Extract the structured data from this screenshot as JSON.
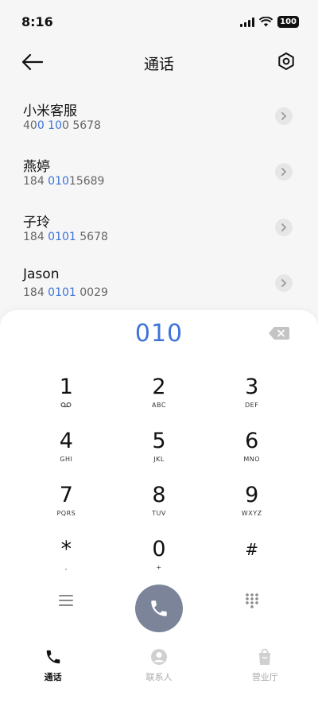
{
  "status_bar": {
    "time": "8:16",
    "battery": "100"
  },
  "header": {
    "title": "通话"
  },
  "results": [
    {
      "name": "小米客服",
      "number_parts": [
        "40",
        "0 10",
        "0 5678"
      ]
    },
    {
      "name": "燕婷",
      "number_parts": [
        "184 ",
        "010",
        "15689"
      ]
    },
    {
      "name": "子玲",
      "number_parts": [
        "184 ",
        "0101",
        " 5678"
      ]
    },
    {
      "name": "Jason",
      "number_parts": [
        "184 ",
        "0101",
        " 0029"
      ]
    }
  ],
  "dialer": {
    "typed_number": "010",
    "keys": [
      {
        "digit": "1",
        "sub": ""
      },
      {
        "digit": "2",
        "sub": "ABC"
      },
      {
        "digit": "3",
        "sub": "DEF"
      },
      {
        "digit": "4",
        "sub": "GHI"
      },
      {
        "digit": "5",
        "sub": "JKL"
      },
      {
        "digit": "6",
        "sub": "MNO"
      },
      {
        "digit": "7",
        "sub": "PQRS"
      },
      {
        "digit": "8",
        "sub": "TUV"
      },
      {
        "digit": "9",
        "sub": "WXYZ"
      },
      {
        "digit": "*",
        "sub": ","
      },
      {
        "digit": "0",
        "sub": "+"
      },
      {
        "digit": "#",
        "sub": ""
      }
    ]
  },
  "nav": {
    "items": [
      {
        "label": "通话",
        "icon": "phone-icon",
        "active": true
      },
      {
        "label": "联系人",
        "icon": "contact-icon",
        "active": false
      },
      {
        "label": "营业厅",
        "icon": "shopping-bag-icon",
        "active": false
      }
    ]
  },
  "colors": {
    "accent": "#3c74d9",
    "call_button": "#7b8499",
    "background": "#f6f6f6"
  }
}
